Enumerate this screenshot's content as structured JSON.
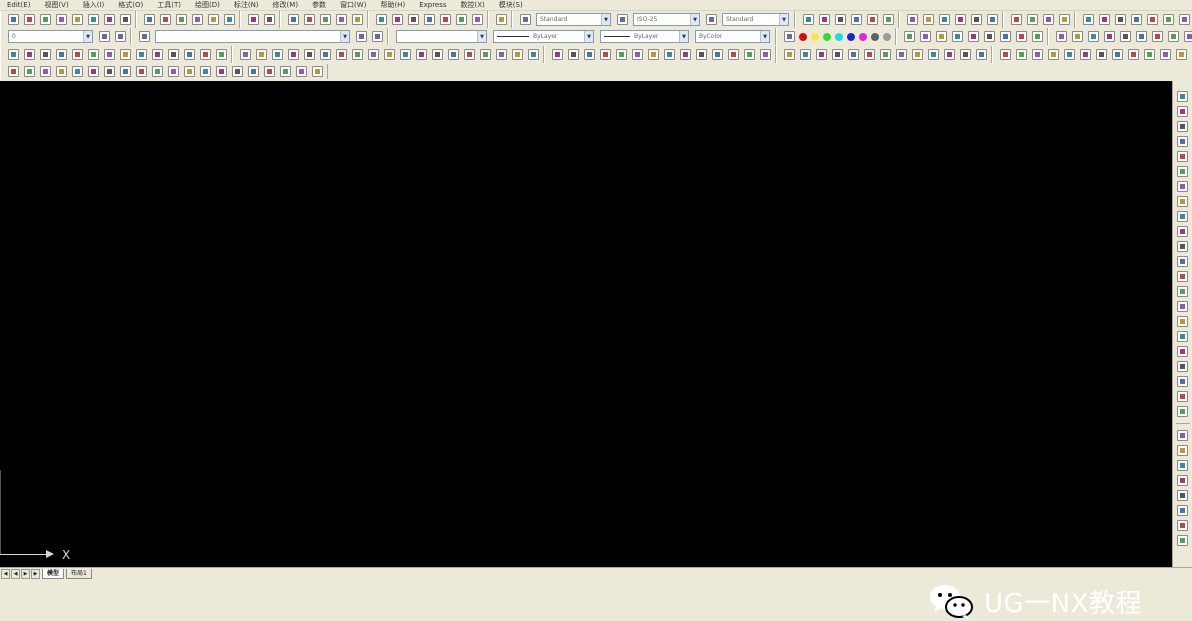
{
  "menu": [
    "Edit(E)",
    "视图(V)",
    "插入(I)",
    "格式(O)",
    "工具(T)",
    "绘图(D)",
    "标注(N)",
    "修改(M)",
    "参数",
    "窗口(W)",
    "帮助(H)",
    "Express",
    "数控(X)",
    "模块(S)"
  ],
  "toolbars": {
    "text_style": "Standard",
    "dim_style": "ISO-25",
    "table_style": "Standard",
    "layer": "0",
    "linetype": "ByLayer",
    "lineweight": "ByLayer",
    "color": "ByColor"
  },
  "colors": {
    "swatches": [
      "#d21010",
      "#f6e64a",
      "#38d838",
      "#26d6e2",
      "#1c28c8",
      "#e028d8",
      "#606060",
      "#9a9a9a"
    ]
  },
  "watermark": {
    "text": "UG一NX教程",
    "icon": "wechat-logo"
  },
  "ucs": {
    "x_label": "X"
  },
  "layout_tabs": [
    "模型",
    "布局1"
  ]
}
